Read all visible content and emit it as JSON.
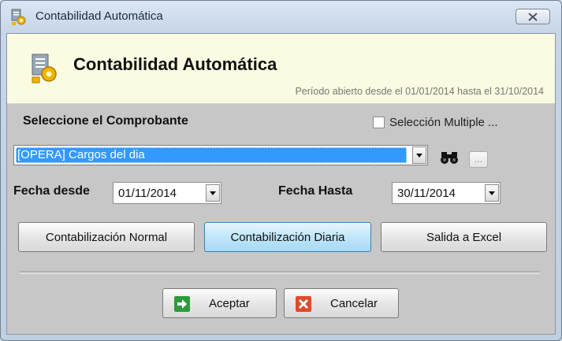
{
  "window": {
    "title": "Contabilidad Automática",
    "icon": "gear-document-icon"
  },
  "header": {
    "title": "Contabilidad Automática",
    "subtitle": "Período abierto desde el 01/01/2014 hasta el 31/10/2014"
  },
  "comprobante": {
    "label": "Seleccione el Comprobante",
    "multi_select_label": "Selección Multiple ...",
    "multi_select_checked": false,
    "selected_value": "[OPERA] Cargos del dia",
    "ellipsis": "..."
  },
  "dates": {
    "desde_label": "Fecha desde",
    "desde_value": "01/11/2014",
    "hasta_label": "Fecha Hasta",
    "hasta_value": "30/11/2014"
  },
  "modes": {
    "normal": "Contabilización Normal",
    "diaria": "Contabilización Diaria",
    "excel": "Salida a Excel",
    "active": "diaria"
  },
  "actions": {
    "accept": "Aceptar",
    "cancel": "Cancelar"
  },
  "colors": {
    "header_bg": "#fbfbe2",
    "selection": "#3399ff",
    "accept_icon": "#2e9a3a",
    "cancel_icon": "#e04a2a"
  }
}
